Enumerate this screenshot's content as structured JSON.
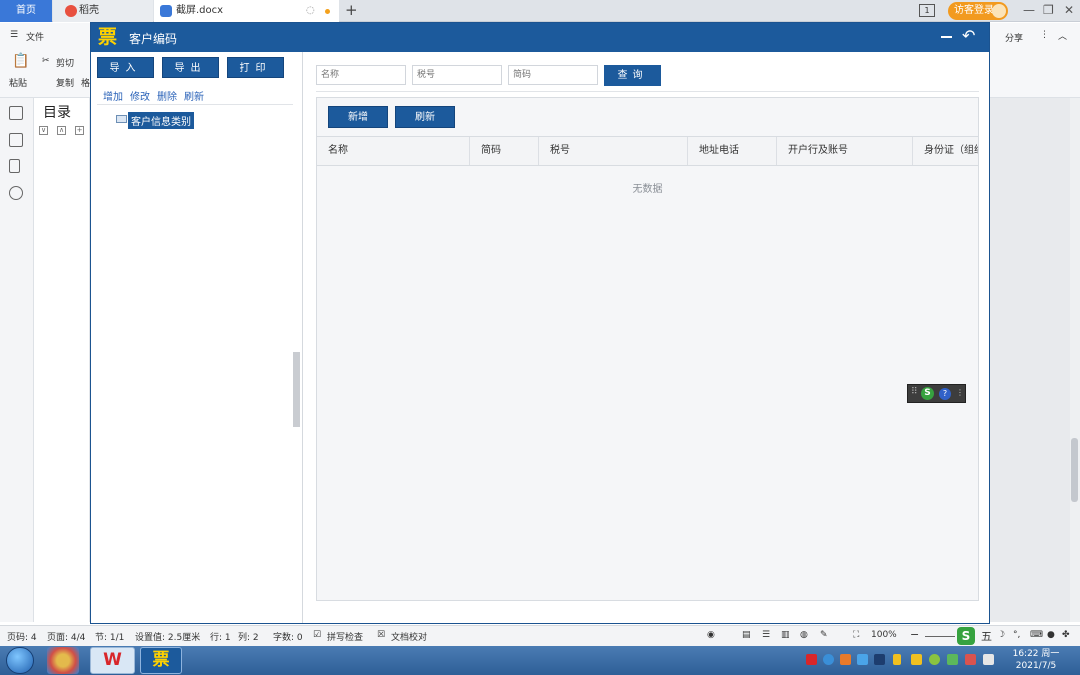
{
  "tabs": {
    "home": "首页",
    "daoke": "稻壳",
    "doc": "截屏.docx",
    "new_tab": "+"
  },
  "titlebar": {
    "page_badge": "1",
    "login": "访客登录"
  },
  "toolbar": {
    "file_menu": "文件",
    "paste": "粘贴",
    "cut": "剪切",
    "copy": "复制",
    "format": "格",
    "share": "分享"
  },
  "toc": {
    "title": "目录"
  },
  "app": {
    "title": "客户编码",
    "logo_char": "票",
    "left": {
      "buttons": {
        "import": "导入",
        "export": "导出",
        "print": "打印"
      },
      "links": {
        "add": "增加",
        "edit": "修改",
        "delete": "删除",
        "refresh": "刷新"
      },
      "tree_root": "客户信息类别"
    },
    "search": {
      "name_placeholder": "名称",
      "tax_placeholder": "税号",
      "code_placeholder": "简码",
      "query_button": "查询"
    },
    "grid": {
      "add_button": "新增",
      "refresh_button": "刷新",
      "columns": [
        "名称",
        "简码",
        "税号",
        "地址电话",
        "开户行及账号",
        "身份证（组织"
      ],
      "empty": "无数据"
    },
    "ime_icon": "S"
  },
  "statusbar": {
    "page_num": "页码: 4",
    "pages": "页面: 4/4",
    "section": "节: 1/1",
    "setting": "设置值: 2.5厘米",
    "row": "行: 1",
    "col": "列: 2",
    "words": "字数: 0",
    "spell": "拼写检查",
    "proof": "文档校对",
    "zoom": "100%",
    "ime_mode": "五"
  },
  "taskbar": {
    "wps_letter": "W",
    "app_char": "票",
    "time": "16:22 周一",
    "date": "2021/7/5"
  },
  "colors": {
    "accent": "#1c5a9c",
    "link": "#2a62b8",
    "brand_yellow": "#ffd200"
  }
}
